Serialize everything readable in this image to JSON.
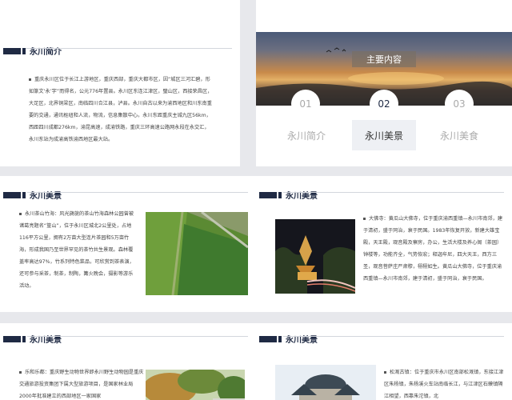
{
  "slides": {
    "intro": {
      "title": "永川简介",
      "text": "重庆永川区位于长江上游地区，重庆西部，重庆大都市区，因“城区三河汇碧，形如篆文‘永’字”而得名，公元776年置县。永川区东连江津区，璧山区，西接荣昌区，大足区，北界铜梁区，南临四川合江县，泸县。永川自古以来为渝西地区和川东南重要的交通，通讯枢纽和人流，物流，信息集散中心。永川东距重庆主城九区56km，西距四川成都276km，渝昆高速，成渝铁路，重庆三环高速公路网永段在永交汇，永川东站为成渝高铁渝西地区最大站。"
    },
    "contents": {
      "heading": "主要内容",
      "tabs": [
        {
          "num": "01",
          "label": "永川简介"
        },
        {
          "num": "02",
          "label": "永川美景"
        },
        {
          "num": "03",
          "label": "永川美食"
        }
      ],
      "active_tab": 1
    },
    "scenery1": {
      "title": "永川美景",
      "text": "永川茶山竹海：风光旖旎的茶山竹海森林公园曾被诸葛亮题名“篁山”，位于永川区城北2公里处，占地116平方公里，拥有2万亩大型连片茶园和5万亩竹海，形成我国乃至世界罕见的茶竹共生景观。森林覆盖率高达97%，竹系列特色菜品，可欣赏到茶表演，还可参与采茶，制茶，制陶，篝火晚会，摄影等游乐活动。"
    },
    "scenery2": {
      "title": "永川美景",
      "text": "大佛寺：黄瓜山大佛寺，位于重庆渝西重镇—永川市南郊，建于清初，盛于同治，衰于民国。1983年恢复开放，新建大雄宝殿，天王殿，观音殿及寮房，办公，生活大楼及养心阁（茶园）钟楼等，功能齐全，气势恢宏；释迦牟尼，四大天王，西方三圣，观音菩萨庄严肃穆，栩栩如生。黄瓜山大佛寺，位于重庆渝西重镇—永川市南郊，建于清初，盛于同治，衰于民国。"
    },
    "scenery3": {
      "title": "永川美景",
      "text": "乐和乐都：重庆野生动物世界即永川野生动物园是重庆交通旅游投资集团下属大型旅游项目，是国家林业局2000年批准建立的西部地区一家国家"
    },
    "scenery4": {
      "title": "永川美景",
      "text": "松溉古镇：位于重庆市永川区南部松溉镇，东接江津区朱杨镇，朱杨溪火车站南临长江，与江津区石蟆镇隔江相望，西靠朱沱镇，北"
    }
  }
}
